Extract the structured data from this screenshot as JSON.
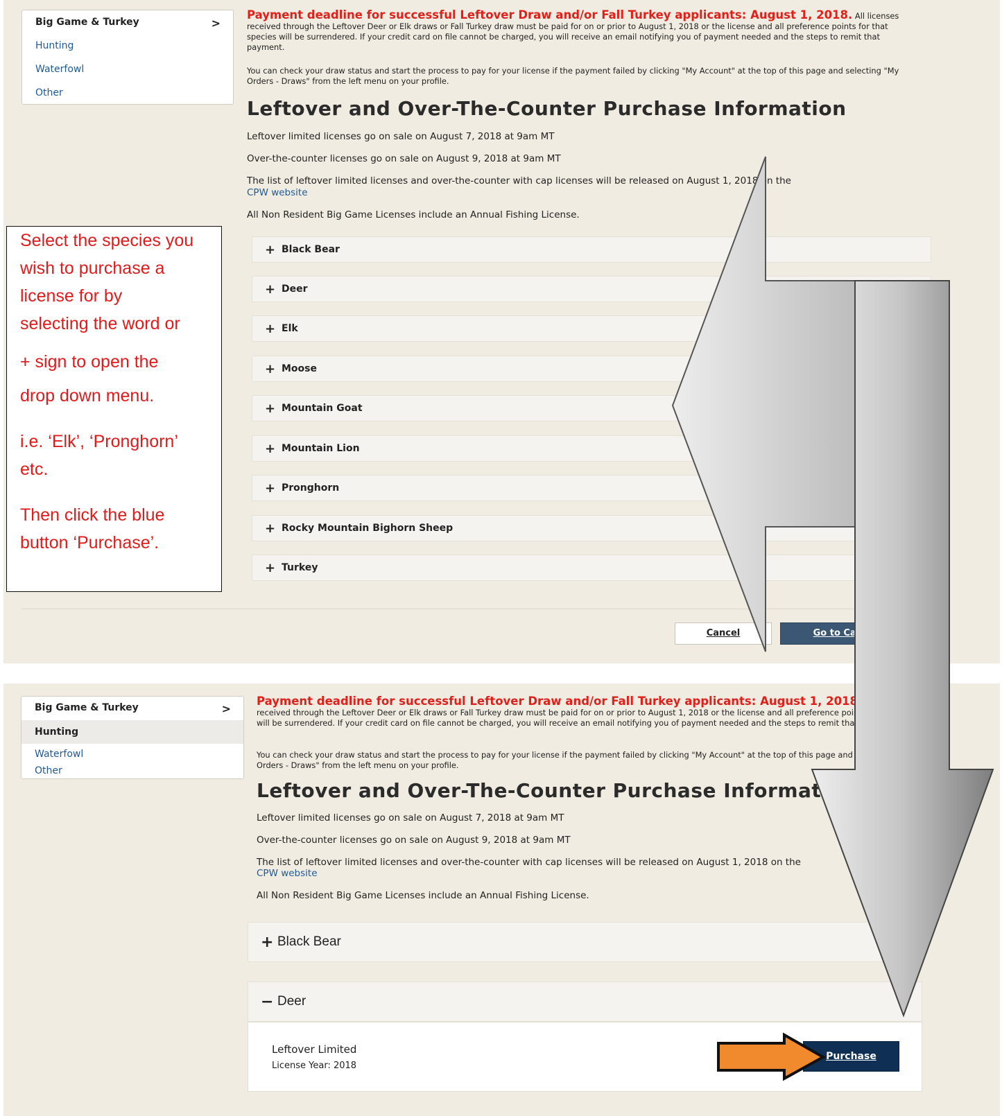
{
  "panel1": {
    "sidebar": {
      "head": "Big Game & Turkey",
      "chevron": ">",
      "items": [
        "Hunting",
        "Waterfowl",
        "Other"
      ]
    },
    "notice_red": "Payment deadline for successful Leftover Draw and/or Fall Turkey applicants: August 1, 2018.",
    "notice_body": "All licenses received through the Leftover Deer or Elk draws or Fall Turkey draw must be paid for on or prior to August 1, 2018 or the license and all preference points for that species will be surrendered. If your credit card on file cannot be charged, you will receive an email notifying you of payment needed and the steps to remit that payment.",
    "status_para": "You can check your draw status and start the process to pay for your license if the payment failed by clicking \"My Account\" at the top of this page and selecting \"My Orders - Draws\" from the left menu on your profile.",
    "heading": "Leftover and Over-The-Counter Purchase Information",
    "line1": "Leftover limited licenses go on sale on August 7, 2018 at 9am MT",
    "line2": "Over-the-counter licenses go on sale on August 9, 2018 at 9am MT",
    "line3": "The list of leftover limited licenses and over-the-counter with cap licenses will be released on August 1, 2018 on the",
    "cpw_link": "CPW website",
    "line4": "All Non Resident Big Game Licenses include an Annual Fishing License.",
    "species": [
      "Black Bear",
      "Deer",
      "Elk",
      "Moose",
      "Mountain Goat",
      "Mountain Lion",
      "Pronghorn",
      "Rocky Mountain Bighorn Sheep",
      "Turkey"
    ],
    "cancel": "Cancel",
    "go": "Go to Cart"
  },
  "callout": {
    "lines": [
      "Select the species you",
      "wish to purchase a",
      "license for by",
      "selecting the word or",
      "+ sign to open the",
      "drop down menu.",
      "i.e. ‘Elk’, ‘Pronghorn’",
      "etc.",
      "Then click the blue",
      "button ‘Purchase’."
    ]
  },
  "panel2": {
    "sidebar": {
      "head": "Big Game & Turkey",
      "chevron": ">",
      "selected": "Hunting",
      "items": [
        "Waterfowl",
        "Other"
      ]
    },
    "heading": "Leftover and Over-The-Counter Purchase Information",
    "species_collapsed": "Black Bear",
    "species_open": "Deer",
    "minus": "−",
    "plus": "+",
    "license_name": "Leftover Limited",
    "license_year": "License Year: 2018",
    "purchase": "Purchase"
  },
  "colors": {
    "page_bg": "#f1ece1",
    "red": "#e0201a",
    "link": "#1f5a96",
    "primary_button": "#0f2f55",
    "orange_arrow": "#f08a2c"
  }
}
